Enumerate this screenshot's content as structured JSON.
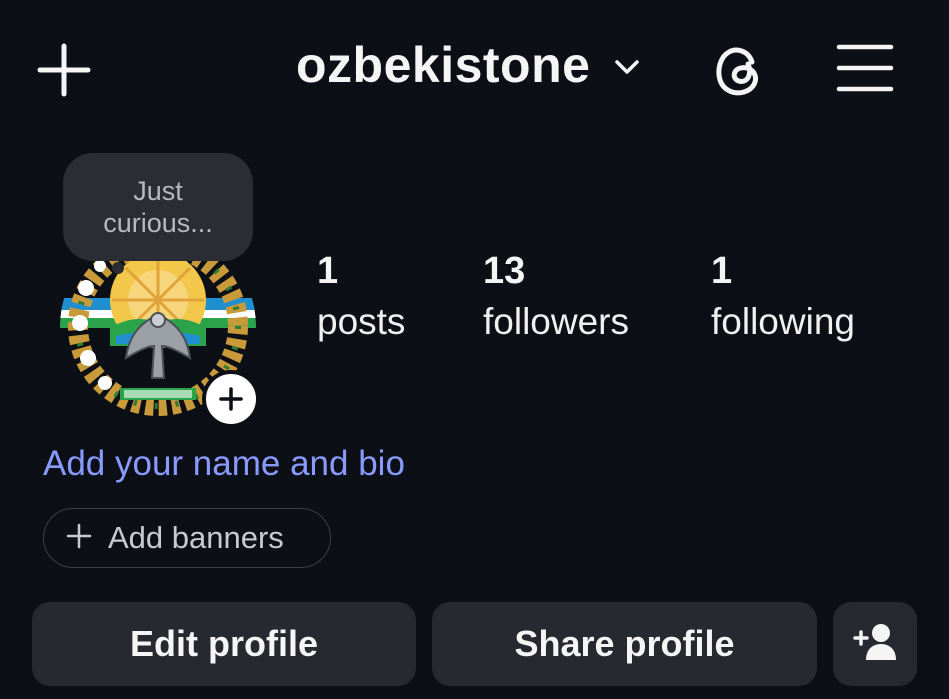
{
  "header": {
    "username": "ozbekistone",
    "icons": [
      "plus-icon",
      "chevron-down-icon",
      "threads-icon",
      "hamburger-menu-icon"
    ]
  },
  "note": {
    "text": "Just curious..."
  },
  "avatar": {
    "description_icon": "emblem-avatar",
    "add_icon": "plus-icon"
  },
  "stats": [
    {
      "count": "1",
      "label": "posts"
    },
    {
      "count": "13",
      "label": "followers"
    },
    {
      "count": "1",
      "label": "following"
    }
  ],
  "bio_link": "Add your name and bio",
  "banners_button": {
    "label": "Add banners",
    "icon": "plus-icon"
  },
  "buttons": {
    "edit": "Edit profile",
    "share": "Share profile",
    "add_user_icon": "add-person-icon"
  },
  "colors": {
    "background": "#0c0f16",
    "link": "#8a9bff",
    "button": "#26292f",
    "note_bubble": "#2a2d34"
  }
}
